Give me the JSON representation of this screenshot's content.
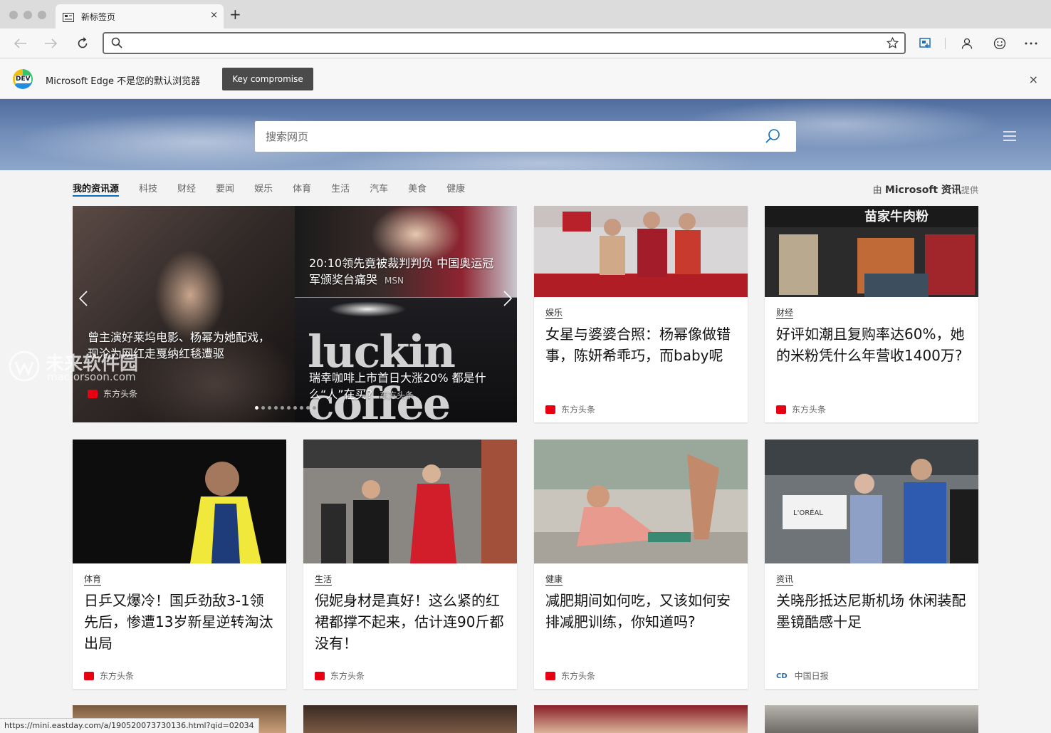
{
  "browser": {
    "tab_title": "新标签页",
    "tab_close": "×",
    "new_tab": "+",
    "address_value": "",
    "infobar_text": "Microsoft Edge 不是您的默认浏览器",
    "infobar_button": "Key compromise",
    "infobar_close": "×",
    "dev_badge": "DEV"
  },
  "hero": {
    "search_placeholder": "搜索网页"
  },
  "nav": {
    "items": [
      "我的资讯源",
      "科技",
      "财经",
      "要闻",
      "娱乐",
      "体育",
      "生活",
      "汽车",
      "美食",
      "健康"
    ],
    "provider_prefix": "由",
    "provider_brand": "Microsoft 资讯",
    "provider_suffix": "提供"
  },
  "carousel": {
    "left_caption": "曾主演好莱坞电影、杨幂为她配戏，现沦为网红走戛纳红毯遭驱",
    "left_source": "东方头条",
    "top_caption": "20:10领先竟被裁判判负 中国奥运冠军颁奖台痛哭",
    "top_source": "MSN",
    "bottom_caption": "瑞幸咖啡上市首日大涨20% 都是什么“人”在买?",
    "bottom_source": "东方头条",
    "bg_text": "luckin coffee",
    "dot_count": 10,
    "active_dot": 0
  },
  "cards": [
    {
      "category": "娱乐",
      "title": "女星与婆婆合照：杨幂像做错事，陈妍希乖巧，而baby呢",
      "source": "东方头条"
    },
    {
      "category": "财经",
      "title": "好评如潮且复购率达60%，她的米粉凭什么年营收1400万?",
      "source": "东方头条"
    },
    {
      "category": "体育",
      "title": "日乒又爆冷！国乒劲敌3-1领先后，惨遭13岁新星逆转淘汰出局",
      "source": "东方头条"
    },
    {
      "category": "生活",
      "title": "倪妮身材是真好！这么紧的红裙都撑不起来，估计连90斤都没有！",
      "source": "东方头条"
    },
    {
      "category": "健康",
      "title": "减肥期间如何吃，又该如何安排减肥训练，你知道吗?",
      "source": "东方头条"
    },
    {
      "category": "资讯",
      "title": "关晓彤抵达尼斯机场 休闲装配墨镜酷感十足",
      "source": "中国日报"
    }
  ],
  "image_text": {
    "shop_sign": "苗家牛肉粉",
    "loreal": "L'ORÉAL"
  },
  "status_url": "https://mini.eastday.com/a/190520073730136.html?qid=02034",
  "watermark": {
    "title": "未来软件园",
    "url": "mac.orsoon.com"
  },
  "colors": {
    "accent": "#0f6cbd",
    "source_badge": "#e60012"
  }
}
